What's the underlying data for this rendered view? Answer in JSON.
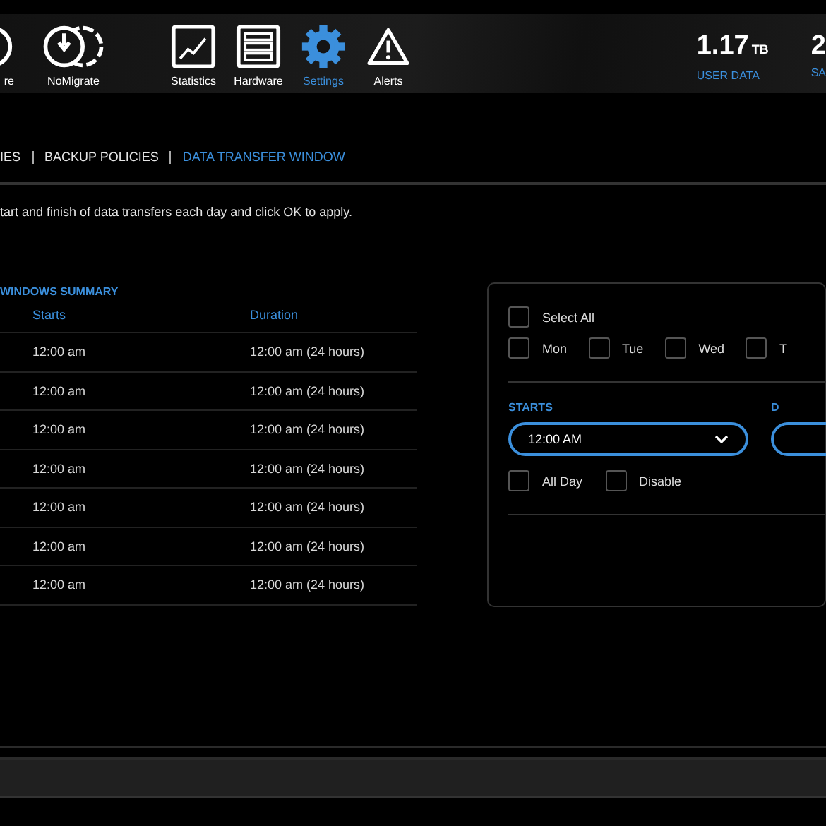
{
  "nav": [
    {
      "label": "re",
      "kind": "restore",
      "selected": false
    },
    {
      "label": "NoMigrate",
      "kind": "nomigrate",
      "selected": false
    },
    {
      "label": "Statistics",
      "kind": "statistics",
      "selected": false
    },
    {
      "label": "Hardware",
      "kind": "hardware",
      "selected": false
    },
    {
      "label": "Settings",
      "kind": "settings",
      "selected": true
    },
    {
      "label": "Alerts",
      "kind": "alerts",
      "selected": false
    }
  ],
  "stats": [
    {
      "value": "1.17",
      "unit": "TB",
      "label": "USER DATA"
    },
    {
      "value": "2",
      "label": "SA"
    }
  ],
  "breadcrumb": [
    {
      "label": "IES",
      "selected": false
    },
    {
      "label": "BACKUP POLICIES",
      "selected": false
    },
    {
      "label": "DATA TRANSFER WINDOW",
      "selected": true
    }
  ],
  "description": "tart and finish of data transfers each day and click OK to apply.",
  "summary": {
    "title": "WINDOWS SUMMARY",
    "columns": [
      "Starts",
      "Duration"
    ],
    "rows": [
      [
        "12:00 am",
        "12:00 am (24 hours)"
      ],
      [
        "12:00 am",
        "12:00 am (24 hours)"
      ],
      [
        "12:00 am",
        "12:00 am (24 hours)"
      ],
      [
        "12:00 am",
        "12:00 am (24 hours)"
      ],
      [
        "12:00 am",
        "12:00 am (24 hours)"
      ],
      [
        "12:00 am",
        "12:00 am (24 hours)"
      ],
      [
        "12:00 am",
        "12:00 am (24 hours)"
      ]
    ]
  },
  "editor": {
    "select_all": {
      "label": "Select All",
      "checked": false
    },
    "days": [
      {
        "label": "Mon",
        "checked": false
      },
      {
        "label": "Tue",
        "checked": false
      },
      {
        "label": "Wed",
        "checked": false
      },
      {
        "label": "T",
        "checked": false
      }
    ],
    "starts": {
      "label": "STARTS",
      "value": "12:00 AM"
    },
    "ends": {
      "label": "D"
    },
    "options": [
      {
        "label": "All Day",
        "checked": false
      },
      {
        "label": "Disable",
        "checked": false
      }
    ]
  }
}
